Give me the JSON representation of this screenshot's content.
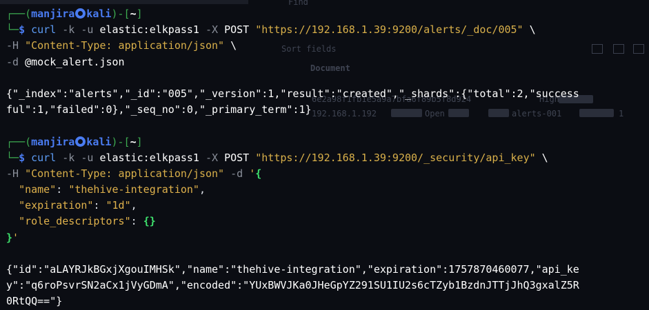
{
  "background_window": {
    "tab": "Find",
    "sort_label": "Sort fields",
    "document_header": "Document",
    "doc_row": "6e2a98f1fb1e5a9a7bfa6f89b5f8d924",
    "doc_row2": "192.168.1.192",
    "severity": "High",
    "status": "Open",
    "index_name": "alerts-001",
    "row_num": "1"
  },
  "prompt": {
    "user": "manjira",
    "host": "kali",
    "dir": "~"
  },
  "cmd1": {
    "line1": {
      "curl": "curl",
      "k": "-k",
      "u": "-u",
      "creds": "elastic:elkpass1",
      "x": "-X",
      "method": "POST",
      "url": "\"https://192.168.1.39:9200/alerts/_doc/005\"",
      "cont": "\\"
    },
    "line2": {
      "h": "-H",
      "header": "\"Content-Type: application/json\"",
      "cont": "\\"
    },
    "line3": {
      "d": "-d",
      "file": "@mock_alert.json"
    }
  },
  "output1": [
    "{\"_index\":\"alerts\",\"_id\":\"005\",\"_version\":1,\"result\":\"created\",\"_shards\":{\"total\":2,\"success",
    "ful\":1,\"failed\":0},\"_seq_no\":0,\"_primary_term\":1}"
  ],
  "cmd2": {
    "line1": {
      "curl": "curl",
      "k": "-k",
      "u": "-u",
      "creds": "elastic:elkpass1",
      "x": "-X",
      "method": "POST",
      "url": "\"https://192.168.1.39:9200/_security/api_key\"",
      "cont": "\\"
    },
    "line2": {
      "h": "-H",
      "header": "\"Content-Type: application/json\"",
      "d": "-d",
      "open_quote": "'",
      "open_brace": "{"
    },
    "body": {
      "name_key": "\"name\"",
      "name_val": "\"thehive-integration\"",
      "exp_key": "\"expiration\"",
      "exp_val": "\"1d\"",
      "role_key": "\"role_descriptors\"",
      "role_val": "{}",
      "close_brace": "}",
      "close_quote": "'"
    }
  },
  "output2": [
    "{\"id\":\"aLAYRJkBGxjXgouIMHSk\",\"name\":\"thehive-integration\",\"expiration\":1757870460077,\"api_ke",
    "y\":\"q6roPsvrSN2aCx1jVyGDmA\",\"encoded\":\"YUxBWVJKa0JHeGpYZ291SU1IU2s6cTZyb1BzdnJTTjJhQ3gxalZ5R",
    "0RtQQ==\"}"
  ],
  "colors": {
    "background": "#0b0d13",
    "prompt_green": "#3daa50",
    "prompt_blue": "#4a7cf2",
    "command_blue": "#5d9cf5",
    "option_gray": "#8a8f9a",
    "string_yellow": "#d9b04a",
    "brace_green": "#3ee06c"
  }
}
